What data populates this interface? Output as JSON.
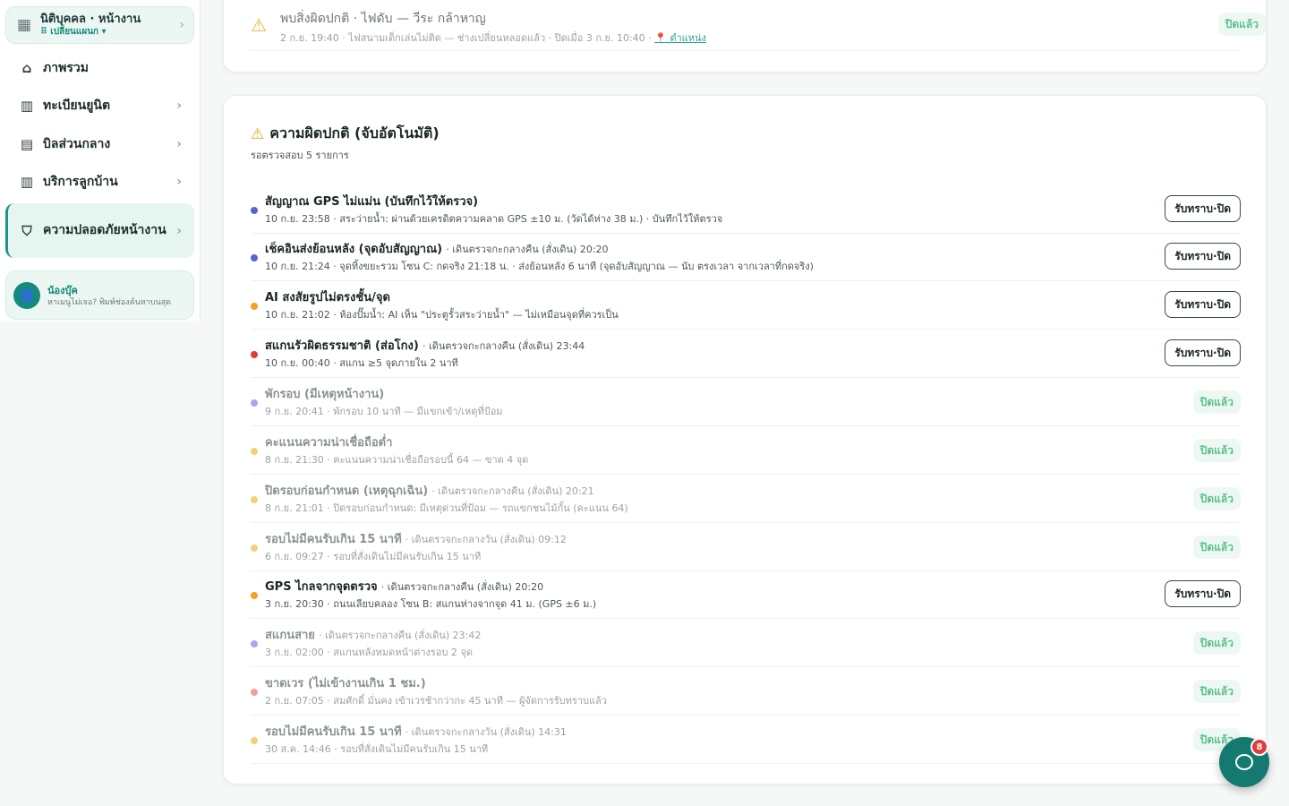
{
  "sidebar": {
    "org_title": "นิติบุคคล · หน้างาน",
    "org_sub": "⠿ เปลี่ยนแผนก ▾",
    "items": [
      {
        "label": "ภาพรวม"
      },
      {
        "label": "ทะเบียนยูนิต"
      },
      {
        "label": "บิลส่วนกลาง"
      },
      {
        "label": "บริการลูกบ้าน"
      },
      {
        "label": "ความปลอดภัยหน้างาน"
      }
    ],
    "help_title": "น้องบุ๊ค",
    "help_sub": "หาเมนูไม่เจอ? พิมพ์ช่องค้นหาบนสุด"
  },
  "top_card": {
    "title": "พบสิ่งผิดปกติ · ไฟดับ — วีระ กล้าหาญ",
    "sub": "2 ก.ย. 19:40 · ไฟสนามเด็กเล่นไม่ติด — ช่างเปลี่ยนหลอดแล้ว · ปิดเมื่อ 3 ก.ย. 10:40 ·",
    "location": "📍 ตำแหน่ง",
    "status": "ปิดแล้ว"
  },
  "anomaly": {
    "title": "ความผิดปกติ (จับอัตโนมัติ)",
    "subtitle": "รอตรวจสอบ 5 รายการ",
    "ack_label": "รับทราบ·ปิด",
    "closed_label": "ปิดแล้ว",
    "rows": [
      {
        "title": "สัญญาณ GPS ไม่แม่น (บันทึกไว้ให้ตรวจ)",
        "sub": "",
        "detail": "10 ก.ย. 23:58 · สระว่ายน้ำ: ผ่านด้วยเครดิตความคลาด GPS ±10 ม. (วัดได้ห่าง 38 ม.) · บันทึกไว้ให้ตรวจ",
        "dot": "#5b5fd6",
        "state": "open"
      },
      {
        "title": "เช็คอินส่งย้อนหลัง (จุดอับสัญญาณ)",
        "sub": "· เดินตรวจกะกลางคืน (สั่งเดิน) 20:20",
        "detail": "10 ก.ย. 21:24 · จุดทิ้งขยะรวม โซน C: กดจริง 21:18 น. · ส่งย้อนหลัง 6 นาที (จุดอับสัญญาณ — นับ ตรงเวลา จากเวลาที่กดจริง)",
        "dot": "#5b5fd6",
        "state": "open"
      },
      {
        "title": "AI สงสัยรูปไม่ตรงชั้น/จุด",
        "sub": "",
        "detail": "10 ก.ย. 21:02 · ห้องปั๊มน้ำ: AI เห็น \"ประตูรั้วสระว่ายน้ำ\" — ไม่เหมือนจุดที่ควรเป็น",
        "dot": "#f0a41d",
        "state": "open"
      },
      {
        "title": "สแกนรัวผิดธรรมชาติ (ส่อโกง)",
        "sub": "· เดินตรวจกะกลางคืน (สั่งเดิน) 23:44",
        "detail": "10 ก.ย. 00:40 · สแกน ≥5 จุดภายใน 2 นาที",
        "dot": "#e23b3b",
        "state": "open"
      },
      {
        "title": "พักรอบ (มีเหตุหน้างาน)",
        "sub": "",
        "detail": "9 ก.ย. 20:41 · พักรอบ 10 นาที — มีแขกเข้า/เหตุที่ป้อม",
        "dot": "#a9a7ee",
        "state": "closed"
      },
      {
        "title": "คะแนนความน่าเชื่อถือต่ำ",
        "sub": "",
        "detail": "8 ก.ย. 21:30 · คะแนนความน่าเชื่อถือรอบนี้ 64 — ขาด 4 จุด",
        "dot": "#f5cf7c",
        "state": "closed"
      },
      {
        "title": "ปิดรอบก่อนกำหนด (เหตุฉุกเฉิน)",
        "sub": "· เดินตรวจกะกลางคืน (สั่งเดิน) 20:21",
        "detail": "8 ก.ย. 21:01 · ปิดรอบก่อนกำหนด: มีเหตุด่วนที่ป้อม — รถแขกชนไม้กั้น (คะแนน 64)",
        "dot": "#f5cf7c",
        "state": "closed"
      },
      {
        "title": "รอบไม่มีคนรับเกิน 15 นาที",
        "sub": "· เดินตรวจกะกลางวัน (สั่งเดิน) 09:12",
        "detail": "6 ก.ย. 09:27 · รอบที่สั่งเดินไม่มีคนรับเกิน 15 นาที",
        "dot": "#f5cf7c",
        "state": "closed"
      },
      {
        "title": "GPS ไกลจากจุดตรวจ",
        "sub": "· เดินตรวจกะกลางคืน (สั่งเดิน) 20:20",
        "detail": "3 ก.ย. 20:30 · ถนนเลียบคลอง โซน B: สแกนห่างจากจุด 41 ม. (GPS ±6 ม.)",
        "dot": "#f0a41d",
        "state": "open"
      },
      {
        "title": "สแกนสาย",
        "sub": "· เดินตรวจกะกลางคืน (สั่งเดิน) 23:42",
        "detail": "3 ก.ย. 02:00 · สแกนหลังหมดหน้าต่างรอบ 2 จุด",
        "dot": "#a9a7ee",
        "state": "closed"
      },
      {
        "title": "ขาดเวร (ไม่เข้างานเกิน 1 ชม.)",
        "sub": "",
        "detail": "2 ก.ย. 07:05 · สมศักดิ์ มั่นคง เข้าเวรช้ากว่ากะ 45 นาที — ผู้จัดการรับทราบแล้ว",
        "dot": "#f0a0a0",
        "state": "closed"
      },
      {
        "title": "รอบไม่มีคนรับเกิน 15 นาที",
        "sub": "· เดินตรวจกะกลางวัน (สั่งเดิน) 14:31",
        "detail": "30 ส.ค. 14:46 · รอบที่สั่งเดินไม่มีคนรับเกิน 15 นาที",
        "dot": "#f5cf7c",
        "state": "closed"
      }
    ]
  },
  "chat": {
    "badge": "8"
  }
}
